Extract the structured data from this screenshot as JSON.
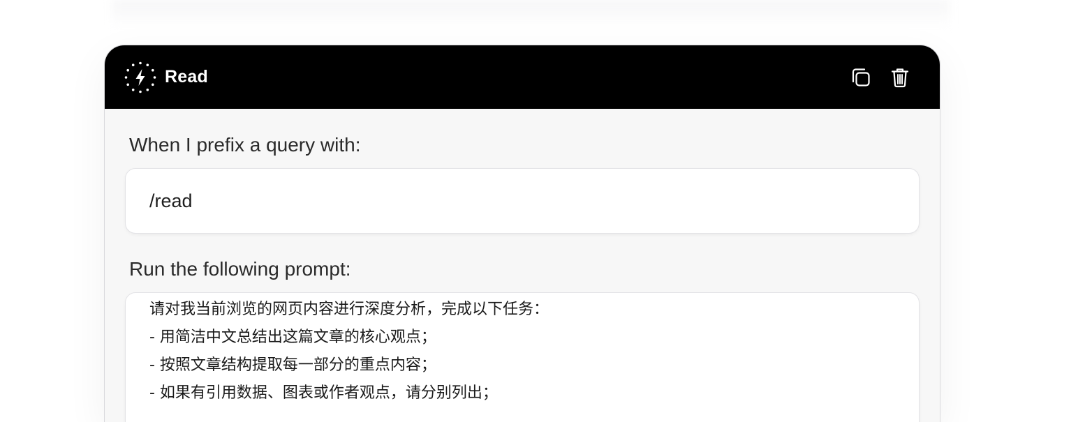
{
  "card": {
    "title": "Read",
    "icon": "lightning-dotted-circle-icon",
    "actions": [
      {
        "name": "copy-button",
        "icon": "copy-icon"
      },
      {
        "name": "delete-button",
        "icon": "trash-icon"
      }
    ]
  },
  "prefix_section": {
    "label": "When I prefix a query with:",
    "value": "/read"
  },
  "prompt_section": {
    "label": "Run the following prompt:",
    "lines": [
      "请对我当前浏览的网页内容进行深度分析，完成以下任务：",
      "- 用简洁中文总结出这篇文章的核心观点；",
      "- 按照文章结构提取每一部分的重点内容；",
      "- 如果有引用数据、图表或作者观点，请分别列出；"
    ]
  },
  "colors": {
    "header_bg": "#000000",
    "card_bg": "#f7f7f7",
    "field_bg": "#ffffff",
    "text": "#2a2a2a"
  }
}
